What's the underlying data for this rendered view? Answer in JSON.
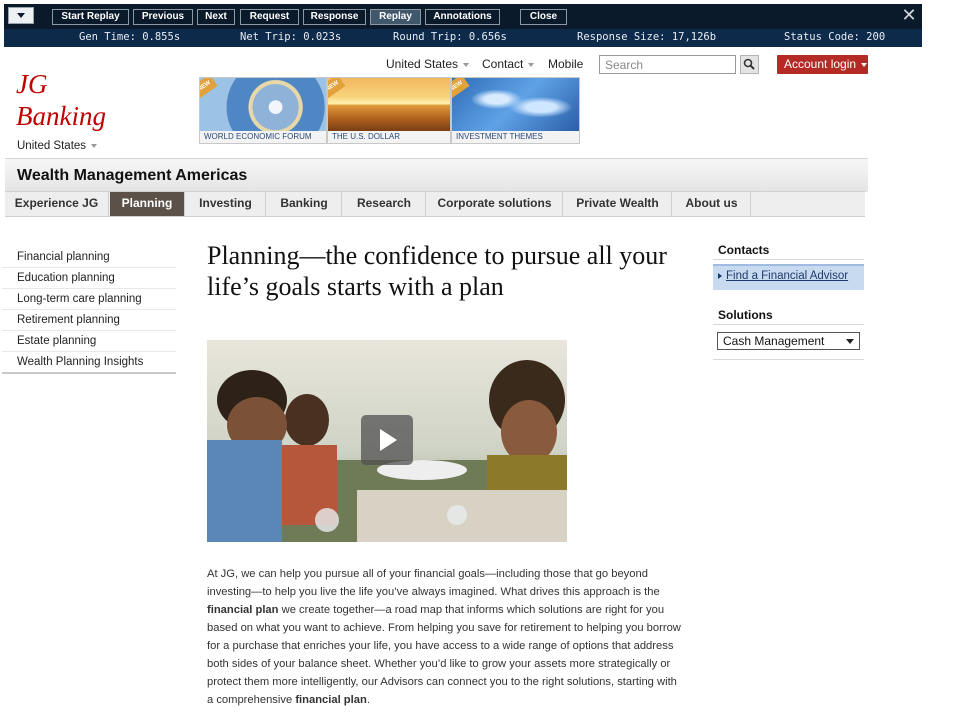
{
  "toolbar": {
    "buttons": [
      "Start Replay",
      "Previous",
      "Next",
      "Request",
      "Response",
      "Replay",
      "Annotations",
      "Close"
    ],
    "active": "Replay"
  },
  "status": {
    "gen_time": "Gen Time: 0.855s",
    "net_trip": "Net Trip: 0.023s",
    "round_trip": "Round Trip: 0.656s",
    "response_size": "Response Size: 17,126b",
    "status_code": "Status Code: 200"
  },
  "header": {
    "logo_line1": "JG",
    "logo_line2": "Banking",
    "country": "United States",
    "top_links": {
      "country": "United States",
      "contact": "Contact",
      "mobile": "Mobile"
    },
    "search_placeholder": "Search",
    "account_login": "Account login"
  },
  "promos": [
    {
      "badge": "NEW",
      "caption": "WORLD ECONOMIC FORUM"
    },
    {
      "badge": "NEW",
      "caption": "THE U.S. DOLLAR"
    },
    {
      "badge": "NEW",
      "caption": "INVESTMENT THEMES"
    }
  ],
  "site": {
    "title": "Wealth Management Americas"
  },
  "mainnav": [
    "Experience JG",
    "Planning",
    "Investing",
    "Banking",
    "Research",
    "Corporate solutions",
    "Private Wealth",
    "About us"
  ],
  "leftnav": [
    "Financial planning",
    "Education planning",
    "Long-term care planning",
    "Retirement planning",
    "Estate planning",
    "Wealth Planning Insights"
  ],
  "main": {
    "headline": "Planning—the confidence to pursue all your life’s goals starts with a plan",
    "paragraph": {
      "p1": "At JG, we can help you pursue all of your financial goals—including those that go beyond investing—to help you live the life you’ve always imagined. What drives this approach is the ",
      "b1": "financial plan",
      "p2": " we create together—a road map that informs which solutions are right for you based on what you want to achieve. From helping you save for retirement to helping you borrow for a purchase that enriches your life, you have access to a wide range of options that address both sides of your balance sheet. Whether you’d like to grow your assets more strategically or protect them more intelligently, our Advisors can connect you to the right solutions, starting with a comprehensive ",
      "b2": "financial plan",
      "p3": "."
    }
  },
  "right": {
    "contacts_title": "Contacts",
    "advisor_link": "Find a Financial Advisor",
    "solutions_title": "Solutions",
    "solutions_selected": "Cash Management"
  }
}
